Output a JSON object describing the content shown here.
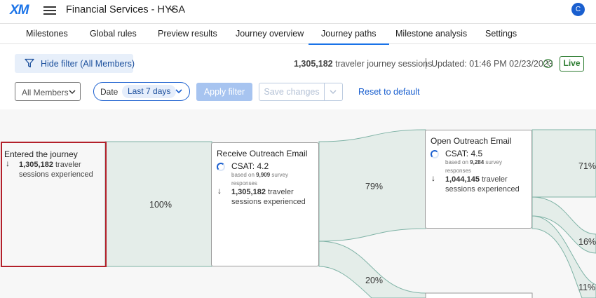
{
  "header": {
    "logo": "XM",
    "project_title": "Financial Services - HYSA",
    "avatar_initial": "C"
  },
  "tabs": [
    {
      "label": "Milestones"
    },
    {
      "label": "Global rules"
    },
    {
      "label": "Preview results"
    },
    {
      "label": "Journey overview"
    },
    {
      "label": "Journey paths",
      "active": true
    },
    {
      "label": "Milestone analysis"
    },
    {
      "label": "Settings"
    }
  ],
  "toolbar": {
    "hide_filter_label": "Hide filter (All Members)",
    "sessions_count": "1,305,182",
    "sessions_text": "traveler journey sessions",
    "updated_text": "Updated: 01:46 PM 02/23/2023",
    "live_label": "Live",
    "members_select": "All Members",
    "date_label": "Date",
    "date_value": "Last 7 days",
    "apply_label": "Apply filter",
    "save_label": "Save changes",
    "reset_label": "Reset to default"
  },
  "journey": {
    "entry": {
      "title": "Entered the journey",
      "count": "1,305,182",
      "count_text": "traveler sessions experienced"
    },
    "nodes": [
      {
        "title": "Receive Outreach Email",
        "csat": "CSAT: 4.2",
        "based_on_prefix": "based on",
        "responses": "9,909",
        "based_on_suffix": "survey responses",
        "count": "1,305,182",
        "count_text": "traveler sessions experienced"
      },
      {
        "title": "Open Outreach Email",
        "csat": "CSAT: 4.5",
        "based_on_prefix": "based on",
        "responses": "9,284",
        "based_on_suffix": "survey responses",
        "count": "1,044,145",
        "count_text": "traveler sessions experienced"
      }
    ],
    "flow_percentages": [
      "100%",
      "79%",
      "20%",
      "71%",
      "16%",
      "11%"
    ]
  },
  "colors": {
    "accent": "#1a73e8",
    "flow_fill": "#e4ede9",
    "flow_stroke": "#7fb3a6",
    "live_green": "#2e7d32",
    "selection_red": "#b3202a"
  },
  "icons": [
    "menu-icon",
    "chevron-down-icon",
    "filter-icon",
    "info-icon",
    "arrow-down-icon",
    "spinner-icon"
  ]
}
